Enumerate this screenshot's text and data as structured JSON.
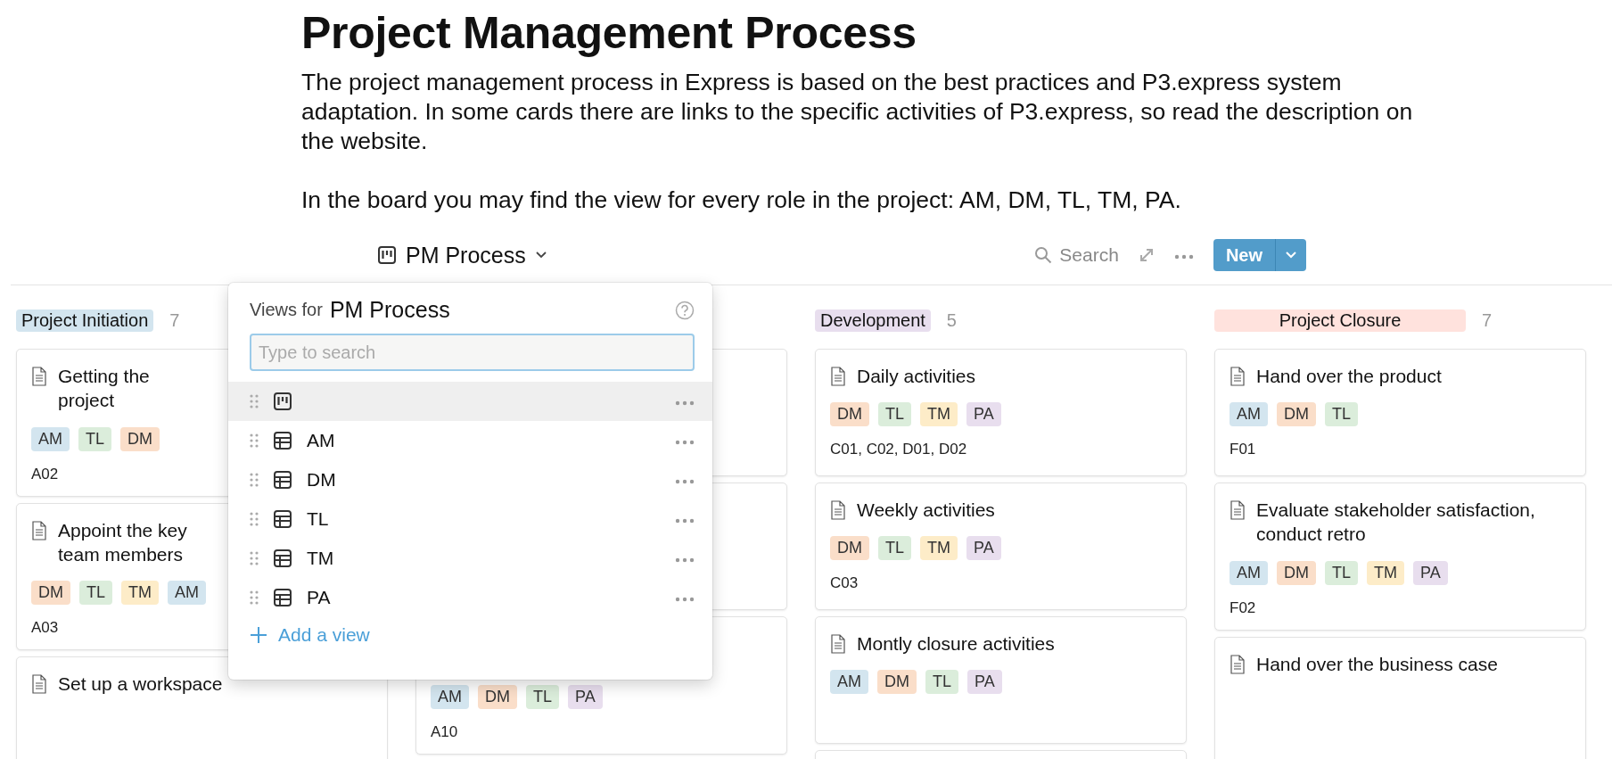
{
  "page": {
    "title": "Project Management Process",
    "paragraphs": [
      "The project management process in Express is based on the best practices and P3.express system adaptation. In some cards there are links to the specific activities of P3.express, so read the description on the website.",
      "In the board you may find the view for every role in the project: AM, DM, TL, TM, PA."
    ]
  },
  "toolbar": {
    "view_name": "PM Process",
    "search_label": "Search",
    "new_label": "New"
  },
  "board": {
    "groups": [
      {
        "name": "Project Initiation",
        "count": "7",
        "color": "#d3e5ef",
        "cards": [
          {
            "kind": "task",
            "title": "Getting the project",
            "tags": [
              {
                "label": "AM",
                "color": "#d3e5ef"
              },
              {
                "label": "TL",
                "color": "#dbeddb"
              },
              {
                "label": "DM",
                "color": "#fadec9"
              }
            ],
            "code": "A02"
          },
          {
            "kind": "task",
            "title": "Appoint the key team members",
            "tags": [
              {
                "label": "DM",
                "color": "#fadec9"
              },
              {
                "label": "TL",
                "color": "#dbeddb"
              },
              {
                "label": "TM",
                "color": "#fdecc8"
              },
              {
                "label": "AM",
                "color": "#d3e5ef"
              }
            ],
            "code": "A03"
          },
          {
            "kind": "task",
            "title": "Set up a workspace"
          }
        ]
      },
      {
        "cards": [
          {
            "kind": "covered"
          },
          {
            "kind": "covered"
          },
          {
            "kind": "task",
            "tags": [
              {
                "label": "AM",
                "color": "#d3e5ef"
              },
              {
                "label": "DM",
                "color": "#fadec9"
              },
              {
                "label": "TL",
                "color": "#dbeddb"
              },
              {
                "label": "PA",
                "color": "#e8deee"
              }
            ],
            "code": "A10"
          }
        ]
      },
      {
        "name": "Development",
        "count": "5",
        "color": "#e8deee",
        "cards": [
          {
            "kind": "task",
            "title": "Daily activities",
            "tags": [
              {
                "label": "DM",
                "color": "#fadec9"
              },
              {
                "label": "TL",
                "color": "#dbeddb"
              },
              {
                "label": "TM",
                "color": "#fdecc8"
              },
              {
                "label": "PA",
                "color": "#e8deee"
              }
            ],
            "code": "C01, C02, D01, D02"
          },
          {
            "kind": "task",
            "title": "Weekly activities",
            "tags": [
              {
                "label": "DM",
                "color": "#fadec9"
              },
              {
                "label": "TL",
                "color": "#dbeddb"
              },
              {
                "label": "TM",
                "color": "#fdecc8"
              },
              {
                "label": "PA",
                "color": "#e8deee"
              }
            ],
            "code": "C03"
          },
          {
            "kind": "task",
            "title": "Montly closure activities",
            "tags": [
              {
                "label": "AM",
                "color": "#d3e5ef"
              },
              {
                "label": "DM",
                "color": "#fadec9"
              },
              {
                "label": "TL",
                "color": "#dbeddb"
              },
              {
                "label": "PA",
                "color": "#e8deee"
              }
            ]
          },
          {
            "kind": "covered"
          }
        ]
      },
      {
        "name": "Project Closure",
        "count": "7",
        "color": "#ffe2dd",
        "cards": [
          {
            "kind": "task",
            "title": "Hand over the product",
            "tags": [
              {
                "label": "AM",
                "color": "#d3e5ef"
              },
              {
                "label": "DM",
                "color": "#fadec9"
              },
              {
                "label": "TL",
                "color": "#dbeddb"
              }
            ],
            "code": "F01"
          },
          {
            "kind": "task",
            "title": "Evaluate stakeholder satisfaction, conduct retro",
            "tags": [
              {
                "label": "AM",
                "color": "#d3e5ef"
              },
              {
                "label": "DM",
                "color": "#fadec9"
              },
              {
                "label": "TL",
                "color": "#dbeddb"
              },
              {
                "label": "TM",
                "color": "#fdecc8"
              },
              {
                "label": "PA",
                "color": "#e8deee"
              }
            ],
            "code": "F02"
          },
          {
            "kind": "task",
            "title": "Hand over the business case"
          }
        ]
      }
    ]
  },
  "views_menu": {
    "heading_prefix": "Views for",
    "heading_name": "PM Process",
    "search": {
      "placeholder": "Type to search"
    },
    "items": [
      {
        "kind": "board",
        "selected": true
      },
      {
        "kind": "table",
        "label": "AM",
        "selected": false
      },
      {
        "kind": "table",
        "label": "DM",
        "selected": false
      },
      {
        "kind": "table",
        "label": "TL",
        "selected": false
      },
      {
        "kind": "table",
        "label": "TM",
        "selected": false
      },
      {
        "kind": "table",
        "label": "PA",
        "selected": false
      }
    ],
    "add_label": "Add a view"
  }
}
